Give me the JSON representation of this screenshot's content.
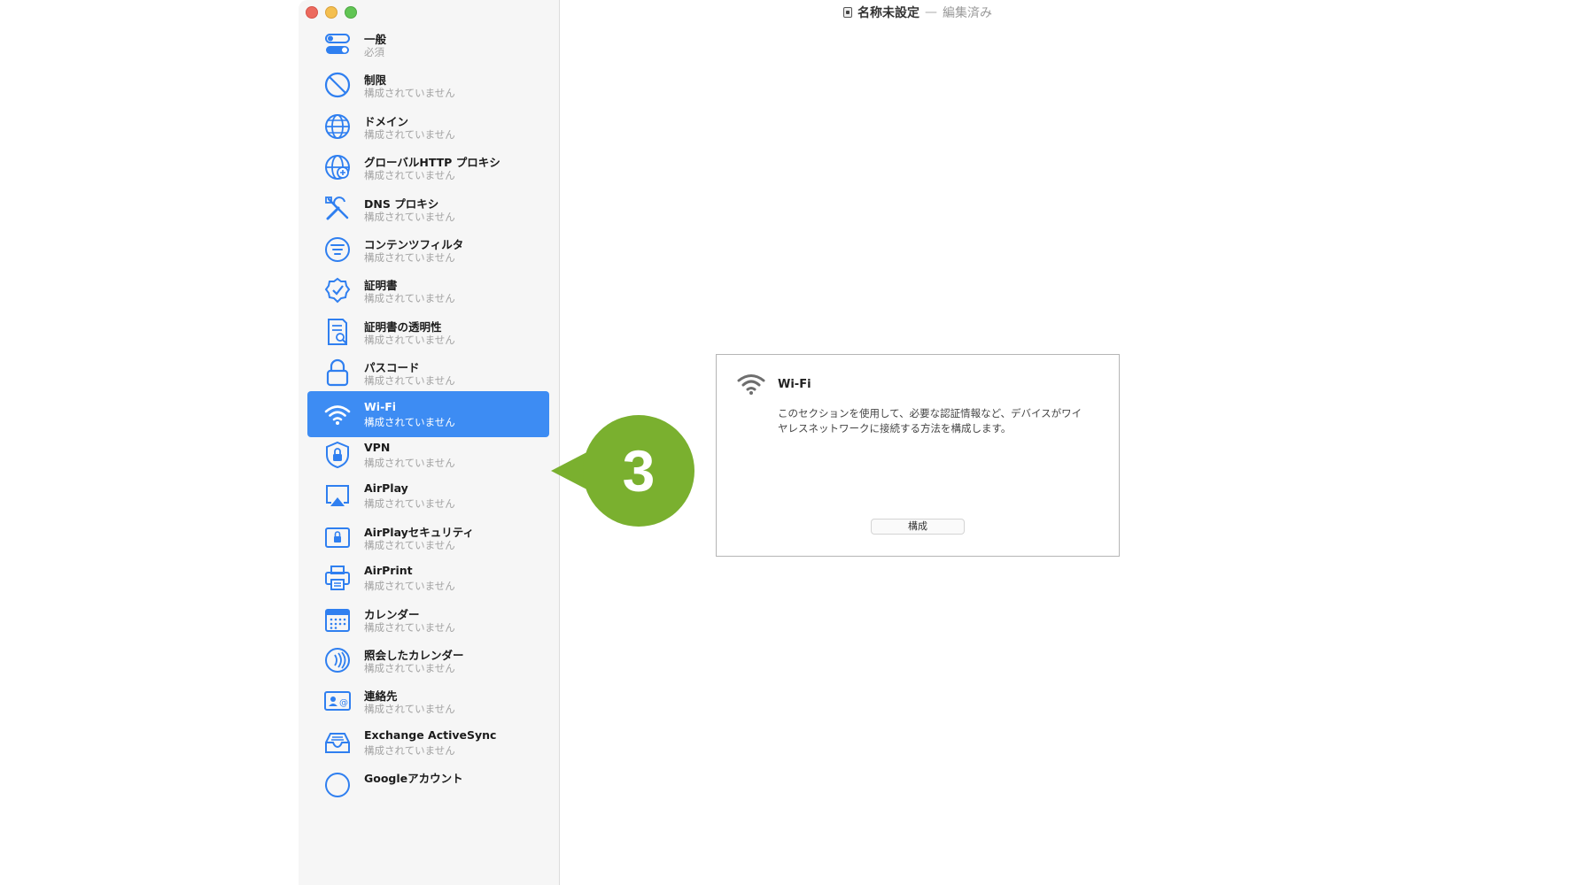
{
  "window": {
    "doc_name": "名称未設定",
    "separator": "—",
    "doc_status": "編集済み"
  },
  "sidebar": {
    "selected_index": 9,
    "items": [
      {
        "label": "一般",
        "sub": "必須",
        "icon": "toggle-icon"
      },
      {
        "label": "制限",
        "sub": "構成されていません",
        "icon": "prohibited-icon"
      },
      {
        "label": "ドメイン",
        "sub": "構成されていません",
        "icon": "globe-icon"
      },
      {
        "label": "グローバルHTTP プロキシ",
        "sub": "構成されていません",
        "icon": "globe-network-icon"
      },
      {
        "label": "DNS プロキシ",
        "sub": "構成されていません",
        "icon": "tools-icon"
      },
      {
        "label": "コンテンツフィルタ",
        "sub": "構成されていません",
        "icon": "filter-icon"
      },
      {
        "label": "証明書",
        "sub": "構成されていません",
        "icon": "certificate-badge-icon"
      },
      {
        "label": "証明書の透明性",
        "sub": "構成されていません",
        "icon": "document-search-icon"
      },
      {
        "label": "パスコード",
        "sub": "構成されていません",
        "icon": "lock-icon"
      },
      {
        "label": "Wi-Fi",
        "sub": "構成されていません",
        "icon": "wifi-icon"
      },
      {
        "label": "VPN",
        "sub": "構成されていません",
        "icon": "shield-lock-icon"
      },
      {
        "label": "AirPlay",
        "sub": "構成されていません",
        "icon": "airplay-icon"
      },
      {
        "label": "AirPlayセキュリティ",
        "sub": "構成されていません",
        "icon": "airplay-lock-icon"
      },
      {
        "label": "AirPrint",
        "sub": "構成されていません",
        "icon": "printer-icon"
      },
      {
        "label": "カレンダー",
        "sub": "構成されていません",
        "icon": "calendar-icon"
      },
      {
        "label": "照会したカレンダー",
        "sub": "構成されていません",
        "icon": "subscribed-calendar-icon"
      },
      {
        "label": "連絡先",
        "sub": "構成されていません",
        "icon": "contact-card-icon"
      },
      {
        "label": "Exchange ActiveSync",
        "sub": "構成されていません",
        "icon": "inbox-tray-icon"
      },
      {
        "label": "Googleアカウント",
        "sub": "",
        "icon": "google-account-icon"
      }
    ]
  },
  "panel": {
    "title": "Wi-Fi",
    "description": "このセクションを使用して、必要な認証情報など、デバイスがワイ\nヤレスネットワークに接続する方法を構成します。",
    "configure_button": "構成"
  },
  "callout": {
    "number": "3",
    "color": "#7ab02f"
  },
  "colors": {
    "accent": "#3d8cf3",
    "icon_blue": "#2f7ff0"
  }
}
